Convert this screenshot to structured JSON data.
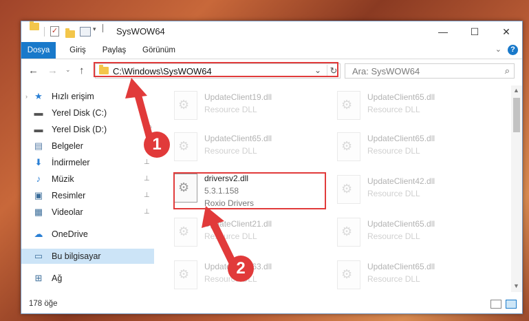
{
  "window": {
    "title": "SysWOW64",
    "controls": {
      "minimize": "—",
      "maximize": "☐",
      "close": "✕"
    }
  },
  "ribbon": {
    "tabs": [
      "Dosya",
      "Giriş",
      "Paylaş",
      "Görünüm"
    ],
    "help": "?"
  },
  "nav": {
    "address": "C:\\Windows\\SysWOW64",
    "search_placeholder": "Ara: SysWOW64"
  },
  "sidebar": {
    "items": [
      {
        "label": "Hızlı erişim",
        "icon": "star-icon"
      },
      {
        "label": "Yerel Disk (C:)",
        "icon": "drive-icon"
      },
      {
        "label": "Yerel Disk (D:)",
        "icon": "drive-icon"
      },
      {
        "label": "Belgeler",
        "icon": "document-icon"
      },
      {
        "label": "İndirmeler",
        "icon": "download-icon"
      },
      {
        "label": "Müzik",
        "icon": "music-icon"
      },
      {
        "label": "Resimler",
        "icon": "pictures-icon"
      },
      {
        "label": "Videolar",
        "icon": "video-icon"
      },
      {
        "label": "OneDrive",
        "icon": "cloud-icon"
      },
      {
        "label": "Bu bilgisayar",
        "icon": "computer-icon"
      },
      {
        "label": "Ağ",
        "icon": "network-icon"
      }
    ]
  },
  "files": {
    "left": [
      {
        "name": "UpdateClient19.dll",
        "type": "Resource DLL"
      },
      {
        "name": "UpdateClient65.dll",
        "type": "Resource DLL"
      },
      {
        "name": "UpdateClient21.dll",
        "type": "Resource DLL"
      },
      {
        "name": "UpdateClient63.dll",
        "type": "Resource DLL"
      }
    ],
    "right": [
      {
        "name": "UpdateClient65.dll",
        "type": "Resource DLL"
      },
      {
        "name": "UpdateClient65.dll",
        "type": "Resource DLL"
      },
      {
        "name": "UpdateClient42.dll",
        "type": "Resource DLL"
      },
      {
        "name": "UpdateClient65.dll",
        "type": "Resource DLL"
      },
      {
        "name": "UpdateClient65.dll",
        "type": "Resource DLL"
      }
    ],
    "selected": {
      "name": "driversv2.dll",
      "version": "5.3.1.158",
      "company": "Roxio Drivers"
    }
  },
  "status": {
    "count": "178 öğe"
  },
  "annotations": {
    "step1": "1",
    "step2": "2",
    "color": "#e13a3a"
  }
}
